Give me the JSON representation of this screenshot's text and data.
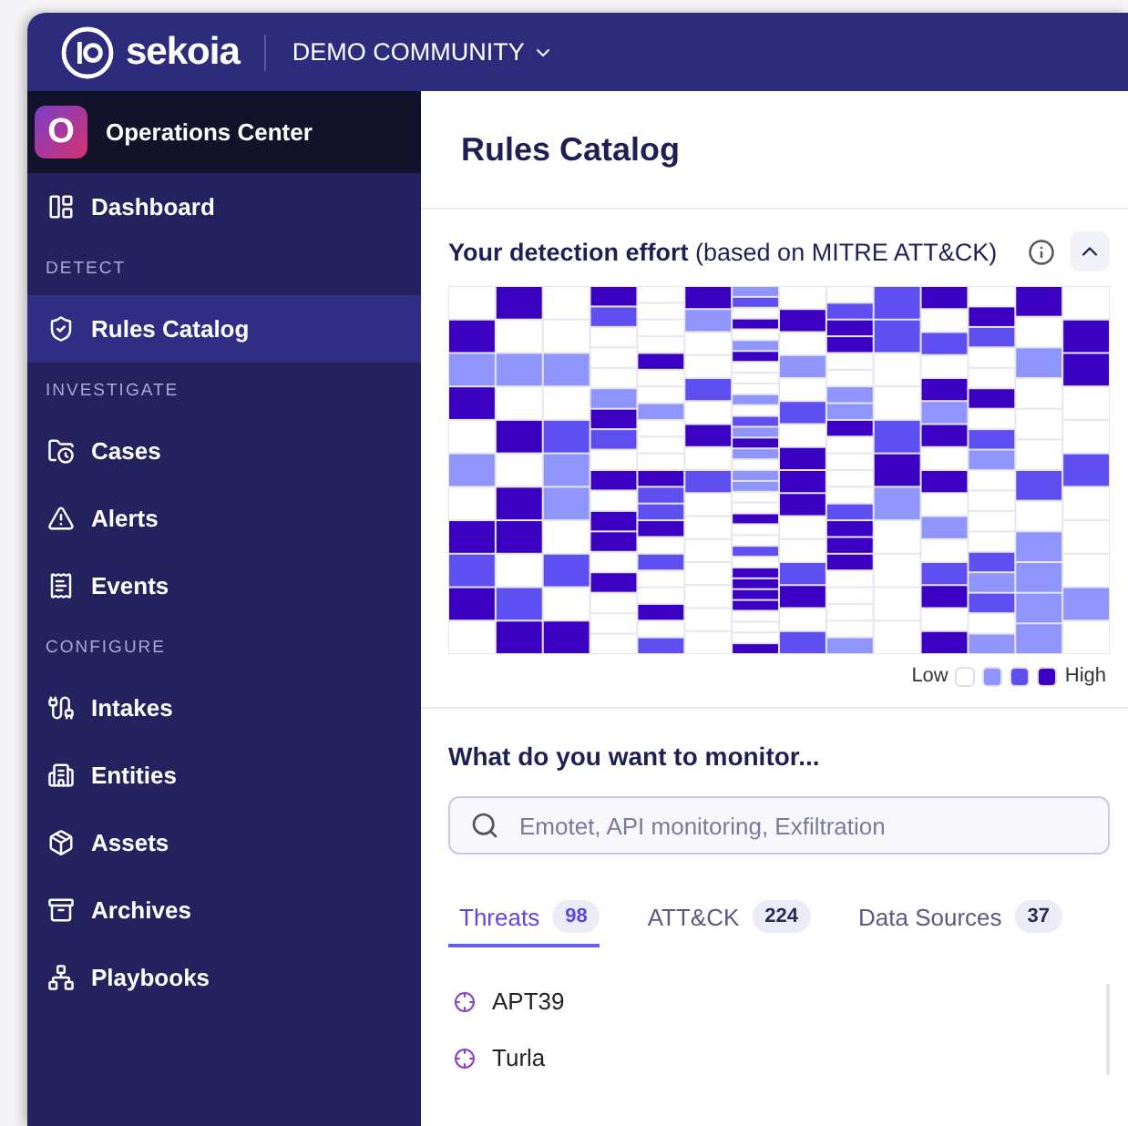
{
  "topbar": {
    "logo": "sekoia",
    "workspace": "DEMO COMMUNITY"
  },
  "sidebar": {
    "product_initial": "O",
    "product": "Operations Center",
    "items": [
      {
        "kind": "item",
        "label": "Dashboard",
        "selected": false
      },
      {
        "kind": "section",
        "label": "DETECT"
      },
      {
        "kind": "item",
        "label": "Rules Catalog",
        "selected": true
      },
      {
        "kind": "section",
        "label": "INVESTIGATE"
      },
      {
        "kind": "item",
        "label": "Cases",
        "selected": false
      },
      {
        "kind": "item",
        "label": "Alerts",
        "selected": false
      },
      {
        "kind": "item",
        "label": "Events",
        "selected": false
      },
      {
        "kind": "section",
        "label": "CONFIGURE"
      },
      {
        "kind": "item",
        "label": "Intakes",
        "selected": false
      },
      {
        "kind": "item",
        "label": "Entities",
        "selected": false
      },
      {
        "kind": "item",
        "label": "Assets",
        "selected": false
      },
      {
        "kind": "item",
        "label": "Archives",
        "selected": false
      },
      {
        "kind": "item",
        "label": "Playbooks",
        "selected": false
      }
    ]
  },
  "main": {
    "title": "Rules Catalog",
    "effort": {
      "title": "Your detection effort",
      "subtitle": "(based on MITRE ATT&CK)",
      "legend_low": "Low",
      "legend_high": "High"
    },
    "monitor": {
      "heading": "What do you want to monitor...",
      "search": {
        "placeholder": "Emotet, API monitoring, Exfiltration"
      },
      "tabs": [
        {
          "label": "Threats",
          "count": "98",
          "selected": true
        },
        {
          "label": "ATT&CK",
          "count": "224",
          "selected": false
        },
        {
          "label": "Data Sources",
          "count": "37",
          "selected": false
        }
      ],
      "results": [
        "APT39",
        "Turla"
      ]
    }
  }
}
